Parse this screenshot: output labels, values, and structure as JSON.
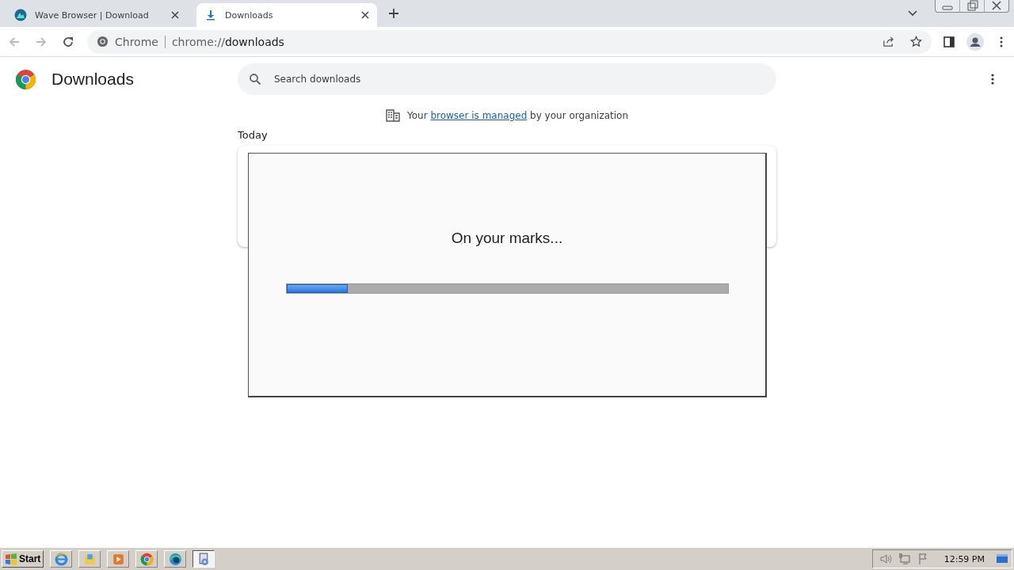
{
  "tabs": [
    {
      "title": "Wave Browser | Download",
      "selected": false
    },
    {
      "title": "Downloads",
      "selected": true
    }
  ],
  "address_bar": {
    "site": "Chrome",
    "url_prefix": "chrome://",
    "url_path": "downloads"
  },
  "page": {
    "title": "Downloads",
    "search": {
      "placeholder": "Search downloads"
    },
    "managed_notice": {
      "before": "Your",
      "link": "browser is managed",
      "after": "by your organization"
    },
    "section": "Today"
  },
  "dialog": {
    "message": "On your marks...",
    "progress": {
      "level": 0.14
    }
  },
  "taskbar": {
    "start": "Start",
    "apps": [
      {
        "selected": false
      },
      {
        "selected": false
      },
      {
        "selected": false
      },
      {
        "selected": false
      },
      {
        "selected": false
      },
      {
        "selected": true
      }
    ],
    "clock": "12:59 PM"
  }
}
